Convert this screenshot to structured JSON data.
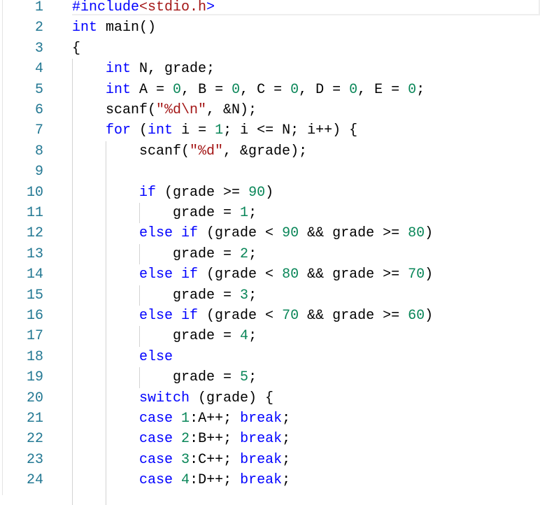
{
  "editor": {
    "colors": {
      "keyword": "#0000ff",
      "number": "#098658",
      "string": "#a31515",
      "line_number": "#237893"
    },
    "lines": [
      [
        [
          "kw",
          "#include"
        ],
        [
          "str",
          "<stdio.h"
        ],
        [
          "kw",
          ">"
        ]
      ],
      [
        [
          "kw",
          "int"
        ],
        [
          "t",
          " main()"
        ]
      ],
      [
        [
          "t",
          "{"
        ]
      ],
      [
        [
          "t",
          "    "
        ],
        [
          "kw",
          "int"
        ],
        [
          "t",
          " N, grade;"
        ]
      ],
      [
        [
          "t",
          "    "
        ],
        [
          "kw",
          "int"
        ],
        [
          "t",
          " A = "
        ],
        [
          "num",
          "0"
        ],
        [
          "t",
          ", B = "
        ],
        [
          "num",
          "0"
        ],
        [
          "t",
          ", C = "
        ],
        [
          "num",
          "0"
        ],
        [
          "t",
          ", D = "
        ],
        [
          "num",
          "0"
        ],
        [
          "t",
          ", E = "
        ],
        [
          "num",
          "0"
        ],
        [
          "t",
          ";"
        ]
      ],
      [
        [
          "t",
          "    scanf("
        ],
        [
          "str",
          "\"%d\\n\""
        ],
        [
          "t",
          ", &N);"
        ]
      ],
      [
        [
          "t",
          "    "
        ],
        [
          "kw",
          "for"
        ],
        [
          "t",
          " ("
        ],
        [
          "kw",
          "int"
        ],
        [
          "t",
          " i = "
        ],
        [
          "num",
          "1"
        ],
        [
          "t",
          "; i <= N; i++) {"
        ]
      ],
      [
        [
          "t",
          "        scanf("
        ],
        [
          "str",
          "\"%d\""
        ],
        [
          "t",
          ", &grade);"
        ]
      ],
      [],
      [
        [
          "t",
          "        "
        ],
        [
          "kw",
          "if"
        ],
        [
          "t",
          " (grade >= "
        ],
        [
          "num",
          "90"
        ],
        [
          "t",
          ")"
        ]
      ],
      [
        [
          "t",
          "            grade = "
        ],
        [
          "num",
          "1"
        ],
        [
          "t",
          ";"
        ]
      ],
      [
        [
          "t",
          "        "
        ],
        [
          "kw",
          "else if"
        ],
        [
          "t",
          " (grade < "
        ],
        [
          "num",
          "90"
        ],
        [
          "t",
          " && grade >= "
        ],
        [
          "num",
          "80"
        ],
        [
          "t",
          ")"
        ]
      ],
      [
        [
          "t",
          "            grade = "
        ],
        [
          "num",
          "2"
        ],
        [
          "t",
          ";"
        ]
      ],
      [
        [
          "t",
          "        "
        ],
        [
          "kw",
          "else if"
        ],
        [
          "t",
          " (grade < "
        ],
        [
          "num",
          "80"
        ],
        [
          "t",
          " && grade >= "
        ],
        [
          "num",
          "70"
        ],
        [
          "t",
          ")"
        ]
      ],
      [
        [
          "t",
          "            grade = "
        ],
        [
          "num",
          "3"
        ],
        [
          "t",
          ";"
        ]
      ],
      [
        [
          "t",
          "        "
        ],
        [
          "kw",
          "else if"
        ],
        [
          "t",
          " (grade < "
        ],
        [
          "num",
          "70"
        ],
        [
          "t",
          " && grade >= "
        ],
        [
          "num",
          "60"
        ],
        [
          "t",
          ")"
        ]
      ],
      [
        [
          "t",
          "            grade = "
        ],
        [
          "num",
          "4"
        ],
        [
          "t",
          ";"
        ]
      ],
      [
        [
          "t",
          "        "
        ],
        [
          "kw",
          "else"
        ]
      ],
      [
        [
          "t",
          "            grade = "
        ],
        [
          "num",
          "5"
        ],
        [
          "t",
          ";"
        ]
      ],
      [
        [
          "t",
          "        "
        ],
        [
          "kw",
          "switch"
        ],
        [
          "t",
          " (grade) {"
        ]
      ],
      [
        [
          "t",
          "        "
        ],
        [
          "kw",
          "case"
        ],
        [
          "t",
          " "
        ],
        [
          "num",
          "1"
        ],
        [
          "t",
          ":A++; "
        ],
        [
          "kw",
          "break"
        ],
        [
          "t",
          ";"
        ]
      ],
      [
        [
          "t",
          "        "
        ],
        [
          "kw",
          "case"
        ],
        [
          "t",
          " "
        ],
        [
          "num",
          "2"
        ],
        [
          "t",
          ":B++; "
        ],
        [
          "kw",
          "break"
        ],
        [
          "t",
          ";"
        ]
      ],
      [
        [
          "t",
          "        "
        ],
        [
          "kw",
          "case"
        ],
        [
          "t",
          " "
        ],
        [
          "num",
          "3"
        ],
        [
          "t",
          ":C++; "
        ],
        [
          "kw",
          "break"
        ],
        [
          "t",
          ";"
        ]
      ],
      [
        [
          "t",
          "        "
        ],
        [
          "kw",
          "case"
        ],
        [
          "t",
          " "
        ],
        [
          "num",
          "4"
        ],
        [
          "t",
          ":D++; "
        ],
        [
          "kw",
          "break"
        ],
        [
          "t",
          ";"
        ]
      ]
    ]
  }
}
